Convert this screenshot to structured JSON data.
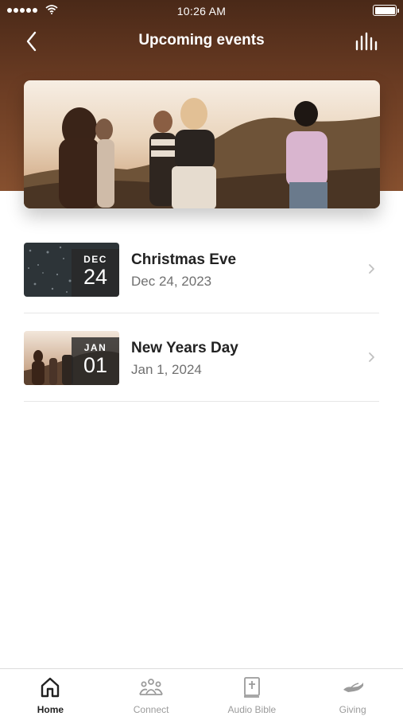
{
  "status_bar": {
    "time": "10:26 AM"
  },
  "nav": {
    "title": "Upcoming events"
  },
  "events": [
    {
      "month": "DEC",
      "day": "24",
      "title": "Christmas Eve",
      "date": "Dec 24, 2023"
    },
    {
      "month": "JAN",
      "day": "01",
      "title": "New Years Day",
      "date": "Jan 1, 2024"
    }
  ],
  "tabs": [
    {
      "label": "Home",
      "icon": "home-icon",
      "active": true
    },
    {
      "label": "Connect",
      "icon": "people-icon",
      "active": false
    },
    {
      "label": "Audio Bible",
      "icon": "bible-icon",
      "active": false
    },
    {
      "label": "Giving",
      "icon": "giving-hand-icon",
      "active": false
    }
  ],
  "colors": {
    "header": "#6b3c23",
    "active_tab": "#222222",
    "inactive_tab": "#9b9b9b"
  }
}
